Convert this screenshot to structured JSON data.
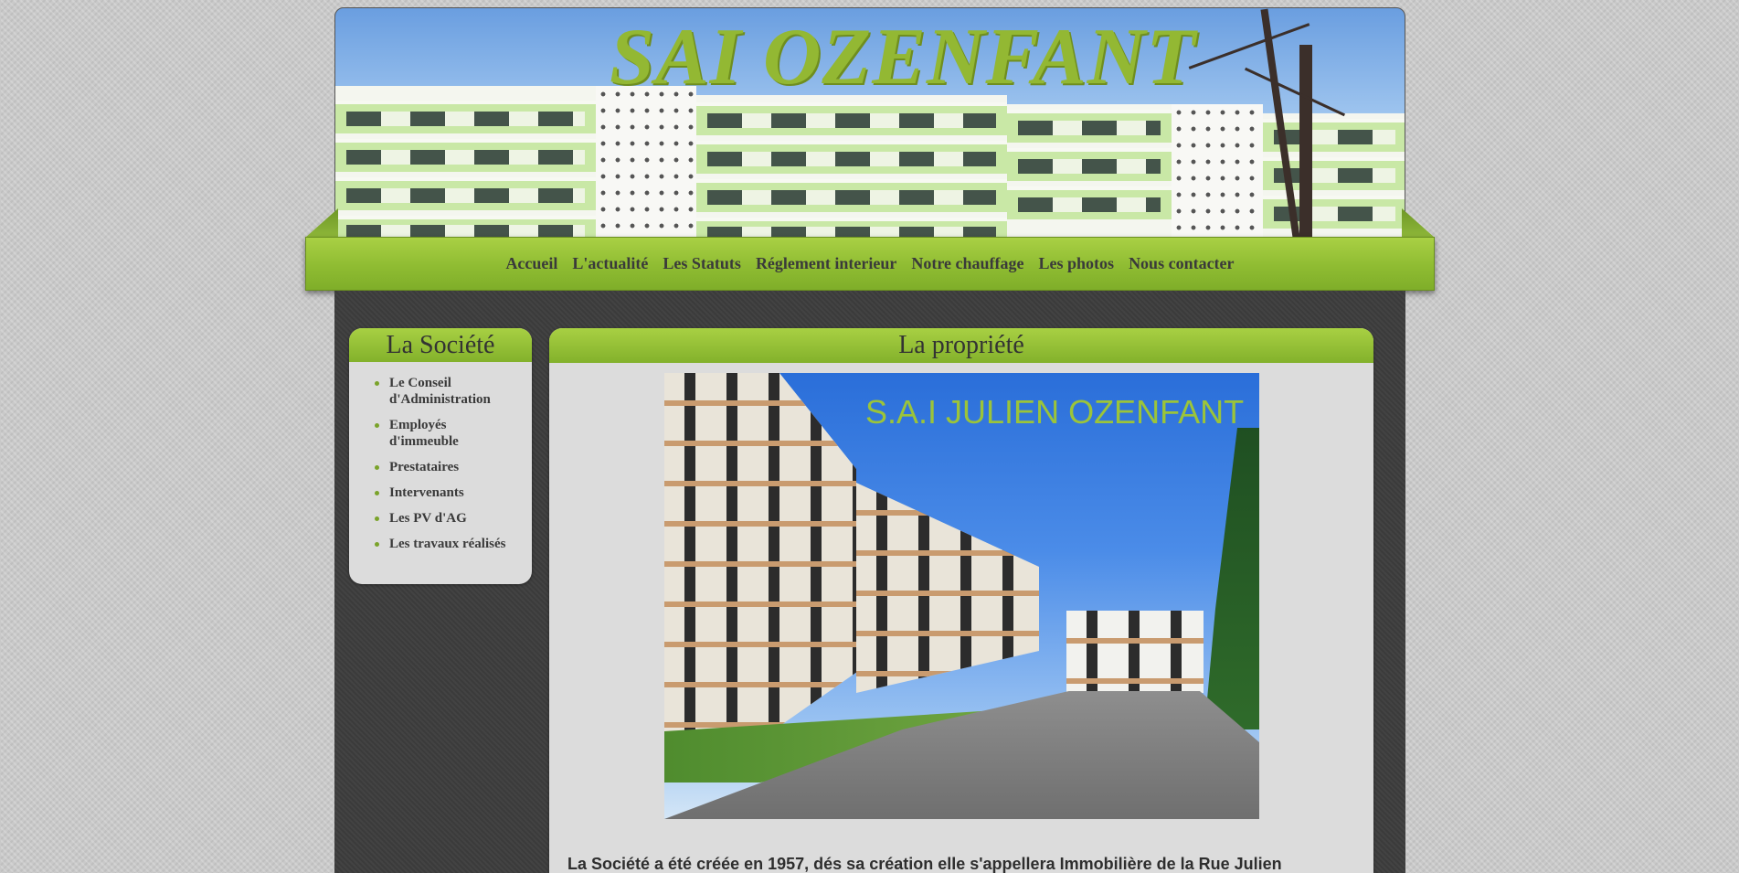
{
  "header": {
    "site_title": "SAI OZENFANT"
  },
  "nav": {
    "items": [
      {
        "label": "Accueil"
      },
      {
        "label": "L'actualité"
      },
      {
        "label": "Les Statuts"
      },
      {
        "label": "Réglement interieur"
      },
      {
        "label": "Notre chauffage"
      },
      {
        "label": "Les photos"
      },
      {
        "label": "Nous contacter"
      }
    ]
  },
  "sidebar": {
    "title": "La Société",
    "items": [
      {
        "label": "Le Conseil d'Administration"
      },
      {
        "label": "Employés d'immeuble"
      },
      {
        "label": "Prestataires"
      },
      {
        "label": "Intervenants"
      },
      {
        "label": "Les PV d'AG"
      },
      {
        "label": "Les travaux réalisés"
      }
    ]
  },
  "content": {
    "title": "La propriété",
    "photo_caption": "S.A.I JULIEN OZENFANT",
    "intro": "La Société a été créée en 1957, dés sa création elle s'appellera Immobilière de la Rue Julien"
  },
  "colors": {
    "accent_green": "#8fbc32",
    "dark_panel": "#3b3b3b",
    "panel_bg": "#dcdcdc",
    "text": "#3a3a3a"
  }
}
